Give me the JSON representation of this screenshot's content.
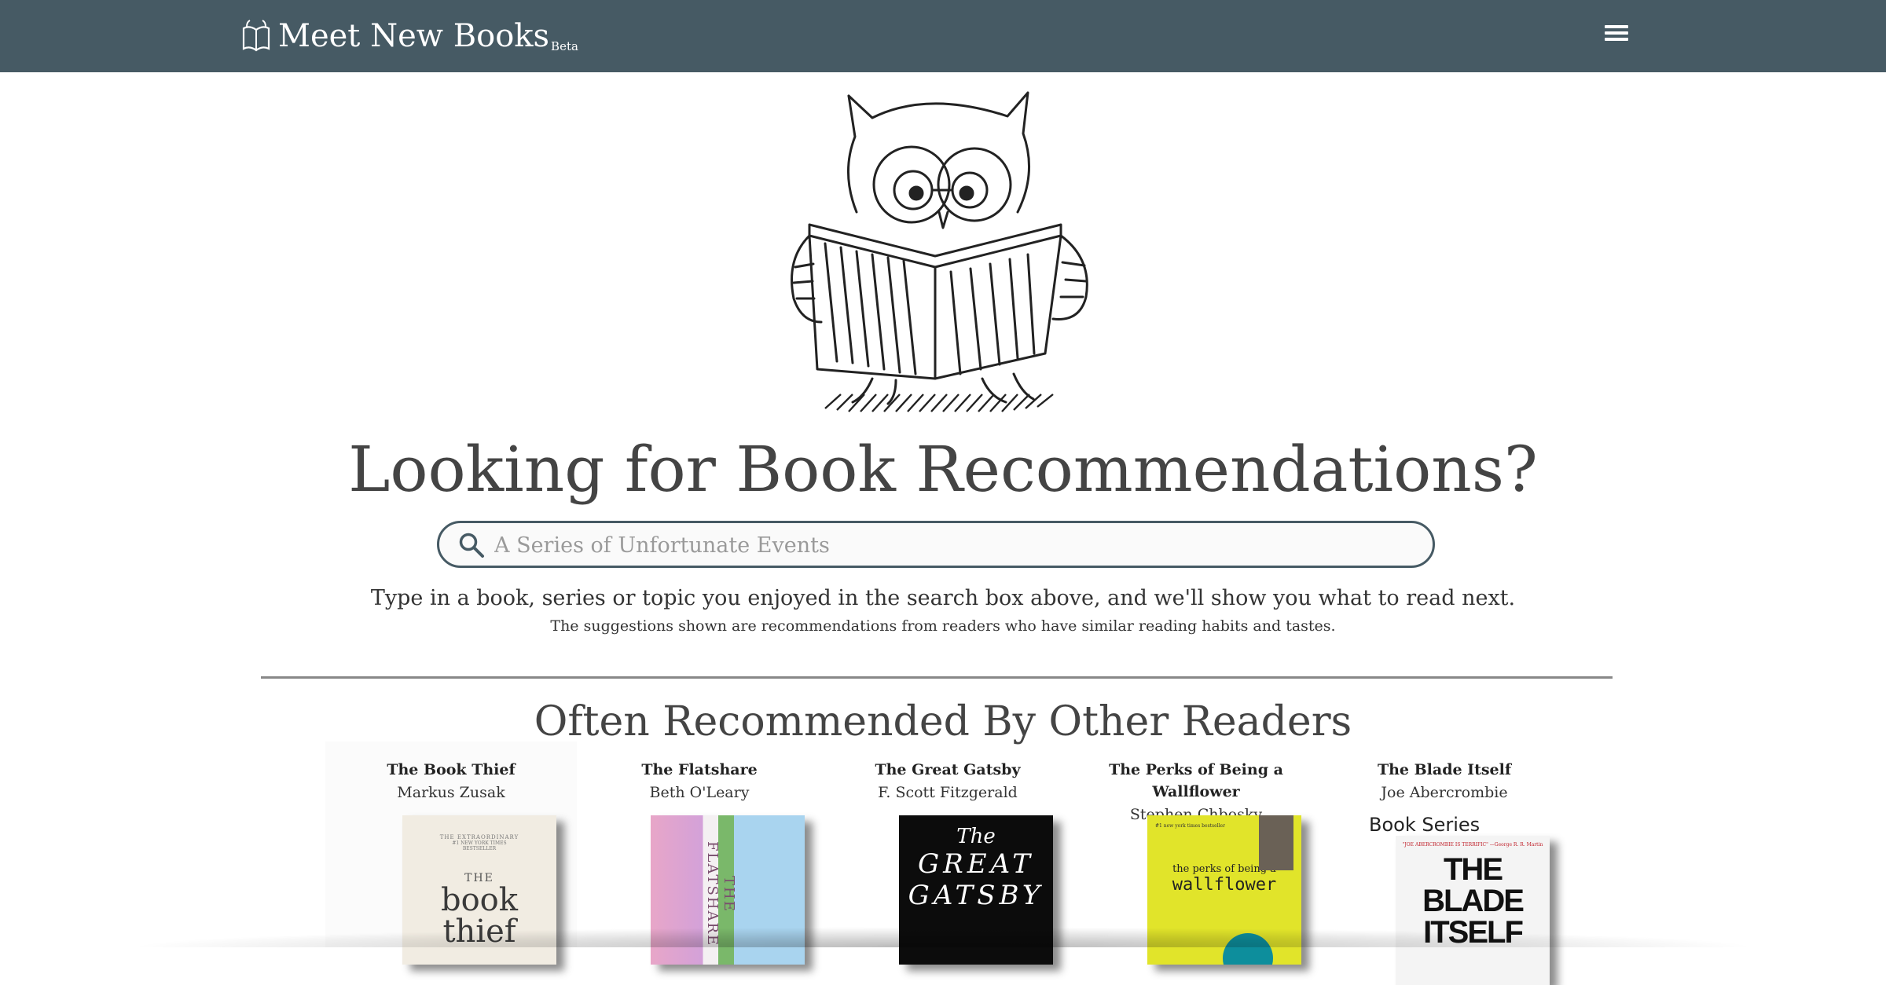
{
  "header": {
    "brand_title": "Meet New Books",
    "brand_badge": "Beta",
    "menu_icon": "hamburger-menu-icon",
    "bg_color": "#465a64"
  },
  "hero": {
    "illustration": "owl-reading-book",
    "title": "Looking for Book Recommendations?",
    "search_placeholder": "A Series of Unfortunate Events",
    "search_value": "",
    "instructions": "Type in a book, series or topic you enjoyed in the search box above, and we'll show you what to read next.",
    "sub_instructions": "The suggestions shown are recommendations from readers who have similar reading habits and tastes."
  },
  "recommended": {
    "title": "Often Recommended By Other Readers",
    "books": [
      {
        "title": "The Book Thief",
        "author": "Markus Zusak",
        "cover_lines": [
          "THE EXTRAORDINARY",
          "#1 NEW YORK TIMES",
          "BESTSELLER",
          "THE",
          "book",
          "thief"
        ]
      },
      {
        "title": "The Flatshare",
        "author": "Beth O'Leary",
        "cover_lines": [
          "THE FLATSHARE"
        ]
      },
      {
        "title": "The Great Gatsby",
        "author": "F. Scott Fitzgerald",
        "cover_lines": [
          "The",
          "GREAT",
          "GATSBY"
        ]
      },
      {
        "title": "The Perks of Being a Wallflower",
        "author": "Stephen Chbosky",
        "cover_lines": [
          "#1 new york times bestseller",
          "the perks of being a",
          "wallflower"
        ]
      },
      {
        "title": "The Blade Itself",
        "author": "Joe Abercrombie",
        "cover_lines": [
          "Book Series",
          "\"JOE ABERCROMBIE IS TERRIFIC\" —George R. R. Martin",
          "THE BLADE",
          "ITSELF"
        ]
      }
    ]
  }
}
